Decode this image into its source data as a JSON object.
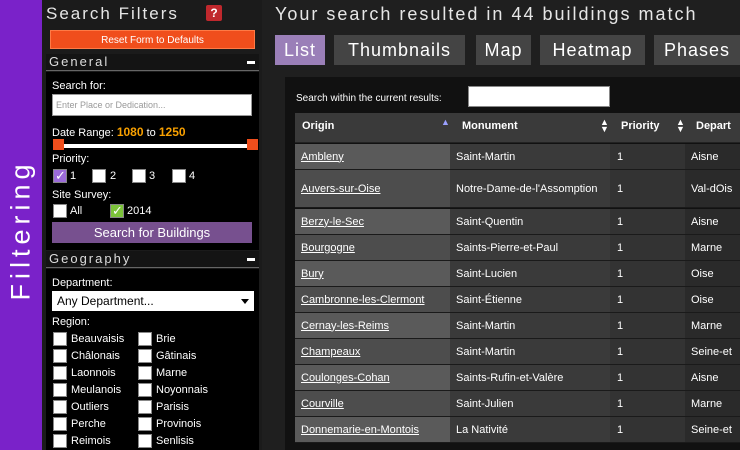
{
  "side_tab": {
    "label": "Filtering"
  },
  "filters": {
    "title": "Search Filters",
    "help_icon": "?",
    "reset_label": "Reset Form to Defaults",
    "general": {
      "heading": "General",
      "search_label": "Search for:",
      "search_placeholder": "Enter Place or Dedication...",
      "date_label": "Date Range:",
      "date_from": "1080",
      "date_to_sep": "to",
      "date_to": "1250",
      "priority_label": "Priority:",
      "priorities": [
        {
          "label": "1",
          "checked": true
        },
        {
          "label": "2",
          "checked": false
        },
        {
          "label": "3",
          "checked": false
        },
        {
          "label": "4",
          "checked": false
        }
      ],
      "survey_label": "Site Survey:",
      "survey": [
        {
          "label": "All",
          "checked": false
        },
        {
          "label": "2014",
          "checked": true
        }
      ],
      "search_button": "Search for Buildings"
    },
    "geography": {
      "heading": "Geography",
      "department_label": "Department:",
      "department_value": "Any Department...",
      "region_label": "Region:",
      "regions_left": [
        "Beauvaisis",
        "Châlonais",
        "Laonnois",
        "Meulanois",
        "Outliers",
        "Perche",
        "Reimois"
      ],
      "regions_right": [
        "Brie",
        "Gâtinais",
        "Marne",
        "Noyonnais",
        "Parisis",
        "Provinois",
        "Senlisis"
      ]
    }
  },
  "results": {
    "title": "Your search resulted in 44 buildings match",
    "tabs": [
      "List",
      "Thumbnails",
      "Map",
      "Heatmap",
      "Phases"
    ],
    "active_tab": 0,
    "within_label": "Search within the current results:",
    "columns": [
      "Origin",
      "Monument",
      "Priority",
      "Depart"
    ],
    "rows": [
      {
        "origin": "Ambleny",
        "monument": "Saint-Martin",
        "priority": "1",
        "department": "Aisne"
      },
      {
        "origin": "Auvers-sur-Oise",
        "monument": "Notre-Dame-de-l'Assomption",
        "priority": "1",
        "department": "Val-dOis"
      },
      {
        "origin": "Berzy-le-Sec",
        "monument": "Saint-Quentin",
        "priority": "1",
        "department": "Aisne"
      },
      {
        "origin": "Bourgogne",
        "monument": "Saints-Pierre-et-Paul",
        "priority": "1",
        "department": "Marne"
      },
      {
        "origin": "Bury",
        "monument": "Saint-Lucien",
        "priority": "1",
        "department": "Oise"
      },
      {
        "origin": "Cambronne-les-Clermont",
        "monument": "Saint-Étienne",
        "priority": "1",
        "department": "Oise"
      },
      {
        "origin": "Cernay-les-Reims",
        "monument": "Saint-Martin",
        "priority": "1",
        "department": "Marne"
      },
      {
        "origin": "Champeaux",
        "monument": "Saint-Martin",
        "priority": "1",
        "department": "Seine-et"
      },
      {
        "origin": "Coulonges-Cohan",
        "monument": "Saints-Rufin-et-Valère",
        "priority": "1",
        "department": "Aisne"
      },
      {
        "origin": "Courville",
        "monument": "Saint-Julien",
        "priority": "1",
        "department": "Marne"
      },
      {
        "origin": "Donnemarie-en-Montois",
        "monument": "La Nativité",
        "priority": "1",
        "department": "Seine-et"
      }
    ]
  },
  "colors": {
    "accent_purple": "#7a22c9",
    "reset_orange": "#f04e1c",
    "date_orange": "#f8a000",
    "active_tab": "#9a7fb8",
    "search_button": "#77508f"
  }
}
